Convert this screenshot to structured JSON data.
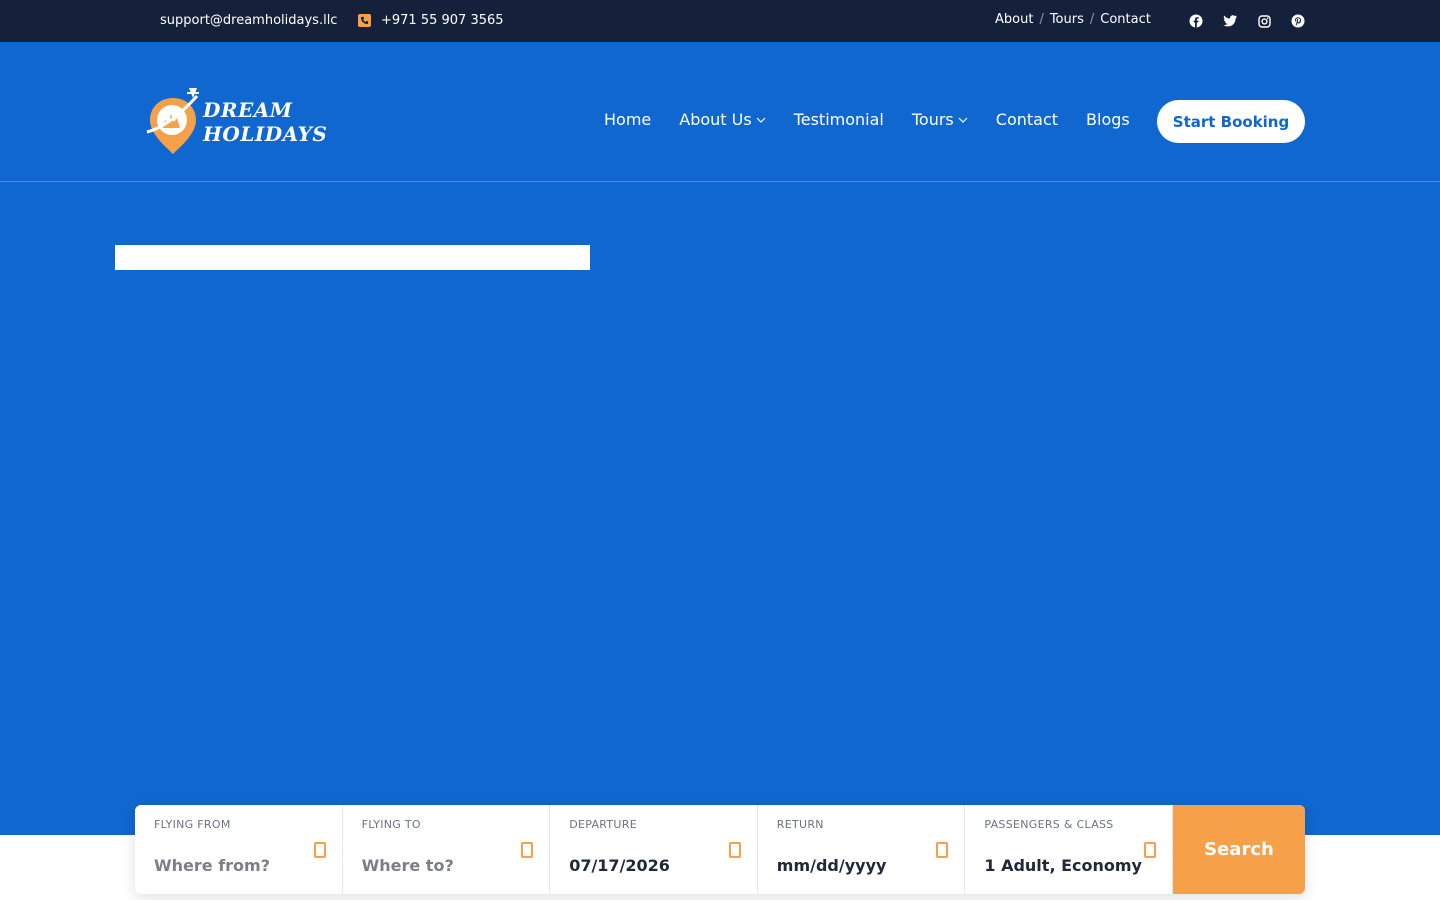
{
  "topbar": {
    "email": "support@dreamholidays.llc",
    "phone": "+971 55 907 3565",
    "links": [
      "About",
      "Tours",
      "Contact"
    ],
    "separator": "/",
    "social": [
      "facebook-icon",
      "twitter-icon",
      "instagram-icon",
      "pinterest-icon"
    ]
  },
  "brand": {
    "line1": "DREAM",
    "line2": "HOLIDAYS"
  },
  "nav": {
    "home": "Home",
    "about": "About Us",
    "testimonial": "Testimonial",
    "tours": "Tours",
    "contact": "Contact",
    "blogs": "Blogs",
    "cta": "Start Booking"
  },
  "search": {
    "from_label": "FLYING FROM",
    "from_placeholder": "Where from?",
    "to_label": "FLYING TO",
    "to_placeholder": "Where to?",
    "departure_label": "DEPARTURE",
    "departure_value": "07/17/2026",
    "return_label": "RETURN",
    "return_value": "mm/dd/yyyy",
    "passengers_label": "PASSENGERS & CLASS",
    "passengers_value": "1 Adult, Economy",
    "button": "Search"
  },
  "colors": {
    "topbar": "#15213b",
    "hero": "#1067cf",
    "accent": "#f6a04a"
  }
}
